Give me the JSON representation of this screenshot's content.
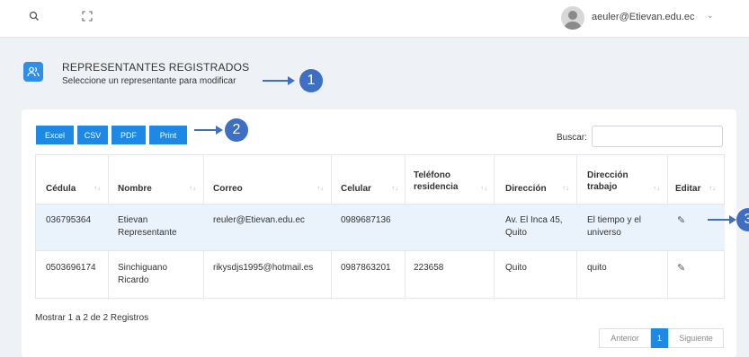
{
  "topbar": {
    "search_icon": "search-icon",
    "expand_icon": "fullscreen-icon",
    "user_email": "aeuler@Etievan.edu.ec"
  },
  "header": {
    "title": "REPRESENTANTES REGISTRADOS",
    "subtitle": "Seleccione un representante para modificar",
    "icon": "users-icon"
  },
  "annotations": [
    "1",
    "2",
    "3"
  ],
  "export_buttons": [
    "Excel",
    "CSV",
    "PDF",
    "Print"
  ],
  "search": {
    "label": "Buscar:",
    "value": ""
  },
  "table": {
    "columns": [
      "Cédula",
      "Nombre",
      "Correo",
      "Celular",
      "Teléfono residencia",
      "Dirección",
      "Dirección trabajo",
      "Editar"
    ],
    "rows": [
      {
        "cedula": "036795364",
        "nombre": "Etievan Representante",
        "correo": "reuler@Etievan.edu.ec",
        "celular": "0989687136",
        "telefono": "",
        "direccion": "Av. El Inca 45, Quito",
        "trabajo": "El tiempo y el universo",
        "edit_icon": "pencil-icon"
      },
      {
        "cedula": "0503696174",
        "nombre": "Sinchiguano Ricardo",
        "correo": "rikysdjs1995@hotmail.es",
        "celular": "0987863201",
        "telefono": "223658",
        "direccion": "Quito",
        "trabajo": "quito",
        "edit_icon": "pencil-icon"
      }
    ]
  },
  "footer": {
    "info": "Mostrar 1 a 2 de 2 Registros",
    "prev": "Anterior",
    "page": "1",
    "next": "Siguiente"
  },
  "colors": {
    "accent": "#1e88e5",
    "annotation": "#3d6fc4",
    "selected_row": "#eaf2fc"
  }
}
